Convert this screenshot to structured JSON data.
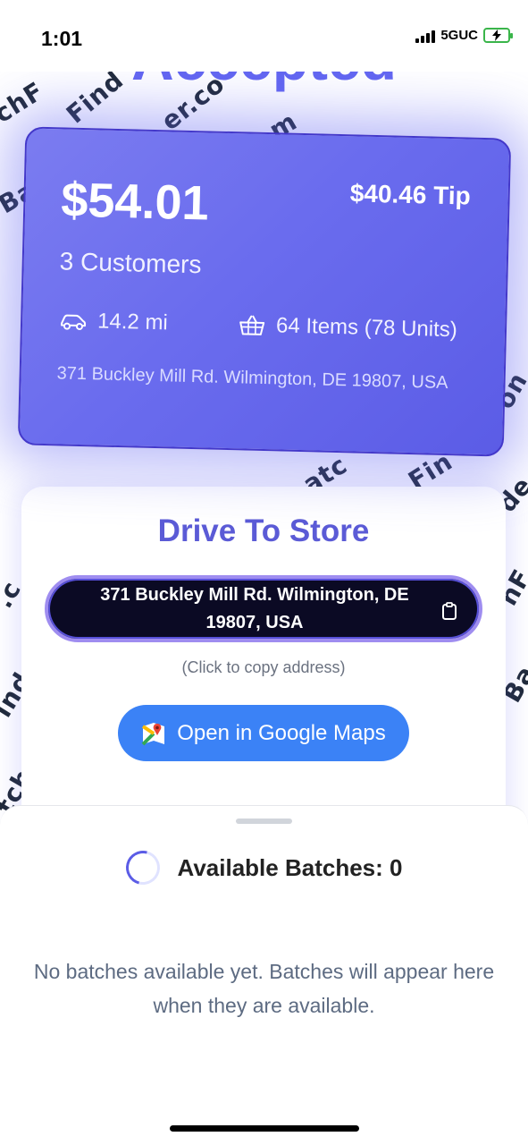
{
  "status_bar": {
    "time": "1:01",
    "network": "5GUC"
  },
  "background": {
    "title": "Accepted",
    "watermarks": [
      "chF",
      "Find",
      "er.co",
      "m",
      "Ba",
      "atc",
      "Fin",
      "on",
      "de",
      ".c",
      "hF",
      "ind",
      "Ba",
      "tch"
    ]
  },
  "summary": {
    "price": "$54.01",
    "tip": "$40.46 Tip",
    "customers": "3 Customers",
    "distance": "14.2 mi",
    "items": "64 Items (78 Units)",
    "address": "371 Buckley Mill Rd. Wilmington, DE 19807, USA"
  },
  "drive": {
    "title": "Drive To Store",
    "address": "371 Buckley Mill Rd. Wilmington, DE 19807, USA",
    "copy_hint": "(Click to copy address)",
    "maps_button_label": "Open in Google Maps"
  },
  "batches": {
    "title": "Available Batches: 0",
    "empty_message": "No batches available yet. Batches will appear here when they are available."
  },
  "colors": {
    "accent": "#6366f1",
    "maps_button": "#3b82f6",
    "pill_background": "#0b0a24"
  },
  "icons": [
    "car-icon",
    "basket-icon",
    "clipboard-icon",
    "google-maps-icon",
    "loading-spinner-icon",
    "signal-icon",
    "battery-charging-icon"
  ]
}
